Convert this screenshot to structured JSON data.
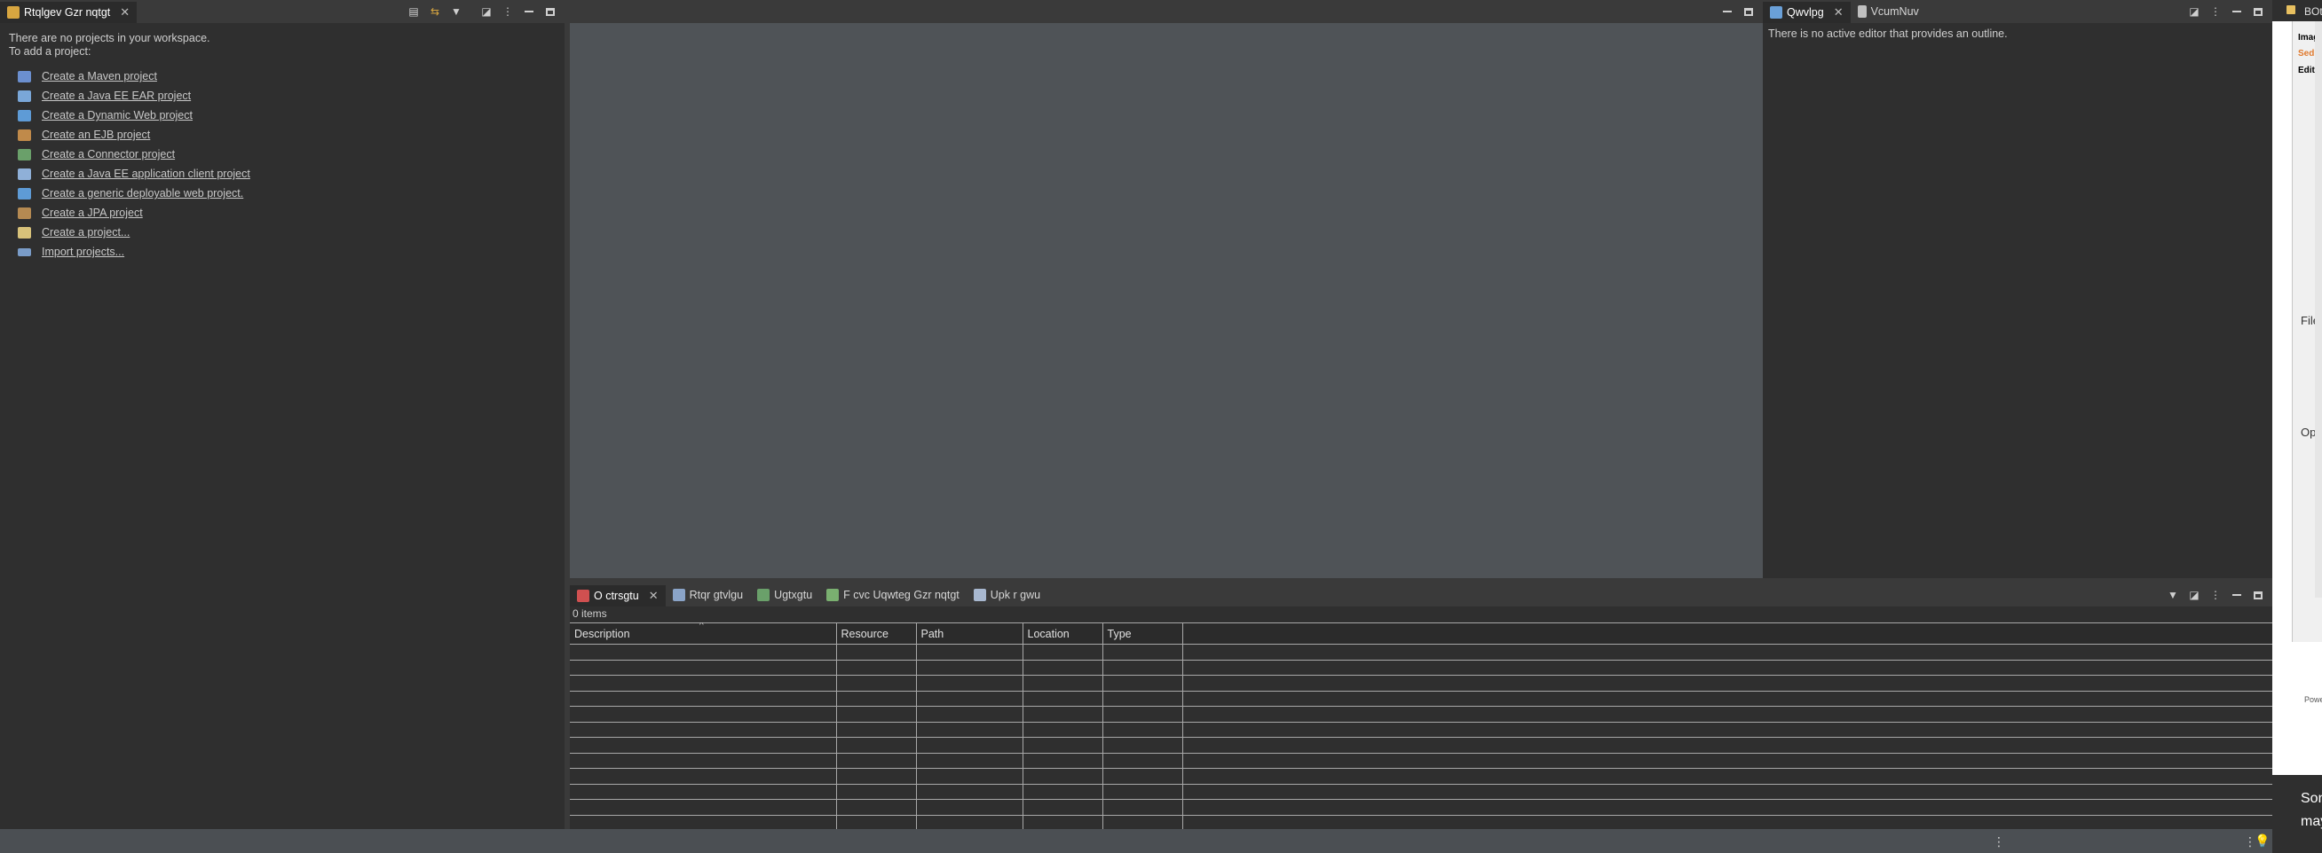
{
  "project_explorer": {
    "tab_label": "Rtqlgev Gzr nqtgt",
    "empty_message_line1": "There are no projects in your workspace.",
    "empty_message_line2": "To add a project:",
    "links": [
      {
        "label": "Create a Maven project",
        "icon": "maven-project-icon",
        "color": "#6b8fcf"
      },
      {
        "label": "Create a Java EE EAR project",
        "icon": "ear-project-icon",
        "color": "#7aa7d8"
      },
      {
        "label": "Create a Dynamic Web project",
        "icon": "web-project-icon",
        "color": "#5e9bd6"
      },
      {
        "label": "Create an EJB project",
        "icon": "ejb-project-icon",
        "color": "#c08a4a"
      },
      {
        "label": "Create a Connector project",
        "icon": "connector-project-icon",
        "color": "#6aa06a"
      },
      {
        "label": "Create a Java EE application client project",
        "icon": "app-client-project-icon",
        "color": "#8fb0d8"
      },
      {
        "label": "Create a generic deployable web project.",
        "icon": "deployable-web-project-icon",
        "color": "#5e9bd6"
      },
      {
        "label": "Create a JPA project",
        "icon": "jpa-project-icon",
        "color": "#b58a52"
      },
      {
        "label": "Create a project...",
        "icon": "new-project-icon",
        "color": "#d8c27a"
      },
      {
        "label": "Import projects...",
        "icon": "import-projects-icon",
        "color": "#7a9cc8"
      }
    ]
  },
  "outline": {
    "tabs": [
      {
        "label": "Qwvlpg",
        "icon": "outline-icon",
        "active": true
      },
      {
        "label": "VcumNuv",
        "icon": "task-list-icon",
        "active": false
      }
    ],
    "empty_message": "There is no active editor that provides an outline."
  },
  "bottom_panel": {
    "tabs": [
      {
        "label": "O ctrsgtu",
        "icon": "markers-icon",
        "active": true
      },
      {
        "label": "Rtqr gtvlgu",
        "icon": "properties-icon",
        "active": false
      },
      {
        "label": "Ugtxgtu",
        "icon": "servers-icon",
        "active": false
      },
      {
        "label": "F cvc Uqwteg Gzr nqtgt",
        "icon": "data-source-explorer-icon",
        "active": false
      },
      {
        "label": "Upk r gwu",
        "icon": "snippets-icon",
        "active": false
      }
    ],
    "item_count": "0 items",
    "columns": [
      "Description",
      "Resource",
      "Path",
      "Location",
      "Type"
    ],
    "empty_rows": 14
  },
  "right_dialog": {
    "title": "BOt",
    "labels": [
      "Imag",
      "Sedi",
      "Editi",
      "File",
      "Opti",
      "Powe"
    ],
    "notice_line1": "Son",
    "notice_line2": "may"
  },
  "colors": {
    "editor_background": "#4f5357",
    "view_background": "#2f2f2f",
    "tab_bar": "#3a3a3a",
    "status_bar": "#4b4f53",
    "accent_orange": "#e07a2e"
  }
}
